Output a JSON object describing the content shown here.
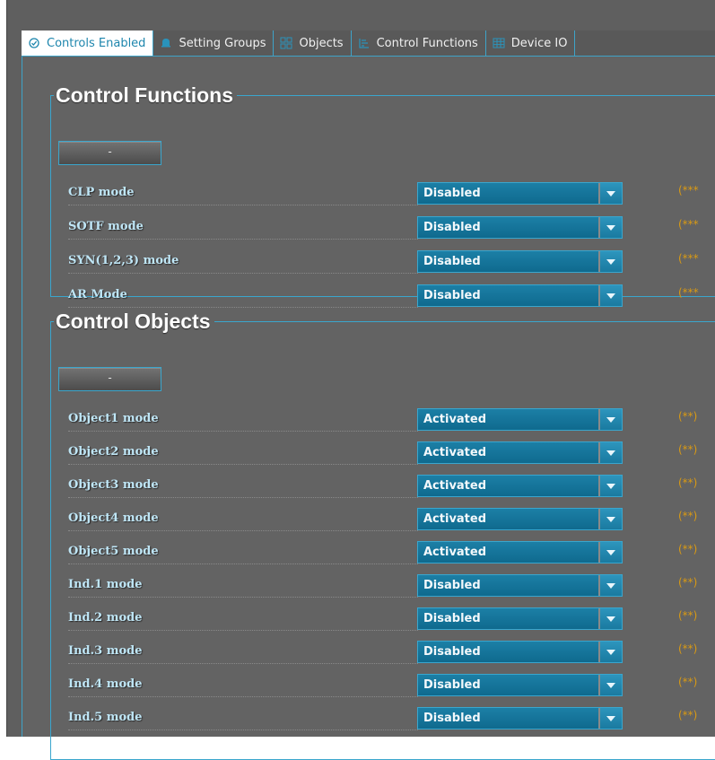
{
  "tabs": [
    {
      "label": "Controls Enabled",
      "icon": "check-circle-icon",
      "active": true
    },
    {
      "label": "Setting Groups",
      "icon": "bell-icon",
      "active": false
    },
    {
      "label": "Objects",
      "icon": "objects-icon",
      "active": false
    },
    {
      "label": "Control Functions",
      "icon": "functions-icon",
      "active": false
    },
    {
      "label": "Device IO",
      "icon": "grid-icon",
      "active": false
    }
  ],
  "control_functions": {
    "title": "Control Functions",
    "collapse_label": "-",
    "rows": [
      {
        "label": "CLP mode",
        "value": "Disabled",
        "note": "(***"
      },
      {
        "label": "SOTF mode",
        "value": "Disabled",
        "note": "(***"
      },
      {
        "label": "SYN(1,2,3) mode",
        "value": "Disabled",
        "note": "(***"
      },
      {
        "label": "AR Mode",
        "value": "Disabled",
        "note": "(***"
      }
    ]
  },
  "control_objects": {
    "title": "Control Objects",
    "collapse_label": "-",
    "rows": [
      {
        "label": "Object1 mode",
        "value": "Activated",
        "note": "(**)"
      },
      {
        "label": "Object2 mode",
        "value": "Activated",
        "note": "(**)"
      },
      {
        "label": "Object3 mode",
        "value": "Activated",
        "note": "(**)"
      },
      {
        "label": "Object4 mode",
        "value": "Activated",
        "note": "(**)"
      },
      {
        "label": "Object5 mode",
        "value": "Activated",
        "note": "(**)"
      },
      {
        "label": "Ind.1 mode",
        "value": "Disabled",
        "note": "(**)"
      },
      {
        "label": "Ind.2 mode",
        "value": "Disabled",
        "note": "(**)"
      },
      {
        "label": "Ind.3 mode",
        "value": "Disabled",
        "note": "(**)"
      },
      {
        "label": "Ind.4 mode",
        "value": "Disabled",
        "note": "(**)"
      },
      {
        "label": "Ind.5 mode",
        "value": "Disabled",
        "note": "(**)"
      }
    ]
  },
  "colors": {
    "accent": "#3aa6cd",
    "select_bg": "#11709a",
    "label_text": "#bfe6f6",
    "note_text": "#d99a14",
    "panel_bg": "#636363"
  }
}
